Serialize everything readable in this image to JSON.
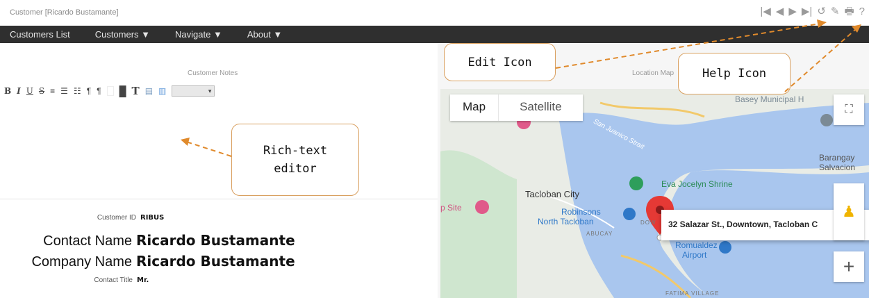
{
  "window": {
    "title": "Customer   [Ricardo Bustamante]"
  },
  "nav_tools": {
    "first": "|◀",
    "prev": "◀",
    "next": "▶",
    "last": "▶|",
    "refresh": "↺",
    "edit": "✎",
    "print": "🖶",
    "help": "?"
  },
  "menu": [
    {
      "label": "Customers List"
    },
    {
      "label": "Customers ▼"
    },
    {
      "label": "Navigate ▼"
    },
    {
      "label": "About ▼"
    }
  ],
  "notes": {
    "label": "Customer Notes",
    "toolbar": [
      "B",
      "I",
      "U",
      "S",
      "≡",
      "☰",
      "☷",
      "¶",
      "¶",
      "",
      "█",
      "T",
      "▤",
      "▥"
    ],
    "select_value": "▾"
  },
  "form": {
    "customer_id": {
      "label": "Customer ID",
      "value": "RIBUS"
    },
    "contact_name": {
      "label": "Contact Name",
      "value": "Ricardo Bustamante"
    },
    "company_name": {
      "label": "Company Name",
      "value": "Ricardo Bustamante"
    },
    "contact_title": {
      "label": "Contact Title",
      "value": "Mr."
    }
  },
  "map": {
    "label": "Location Map",
    "tabs": {
      "map": "Map",
      "satellite": "Satellite"
    },
    "places": {
      "basey": "Basey Municipal H",
      "strait": "San Juanico Strait",
      "barangay": "Barangay",
      "salvacion": "Salvacion",
      "tacloban": "Tacloban City",
      "shrine": "Eva Jocelyn Shrine",
      "robinsons1": "Robinsons",
      "robinsons2": "North Tacloban",
      "site": "p Site",
      "abucay": "ABUCAY",
      "dow": "DOW",
      "romualdez": "Romualdez",
      "airport": "Airport",
      "fatima": "FATIMA VILLAGE"
    },
    "info_window": "32 Salazar St., Downtown, Tacloban C",
    "zoom_in": "+",
    "colors": {
      "water": "#a9c6ee",
      "land": "#e9ece6",
      "park": "#cfe6cf",
      "pin": "#e53935"
    }
  },
  "annotations": {
    "edit_icon": "Edit Icon",
    "help_icon": "Help Icon",
    "rich_text_line1": "Rich-text",
    "rich_text_line2": "editor",
    "color": "#e08a2c"
  }
}
